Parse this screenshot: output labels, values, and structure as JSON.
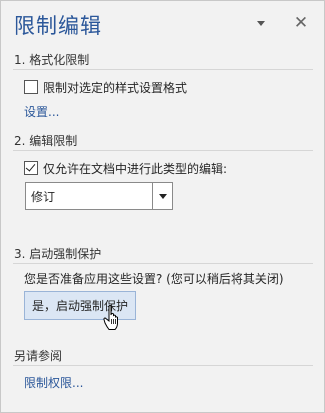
{
  "pane": {
    "title": "限制编辑",
    "menu_icon": "dropdown-triangle-icon",
    "close_icon": "close-icon",
    "close_glyph": "✕"
  },
  "formatting": {
    "heading": "1. 格式化限制",
    "checkbox_label": "限制对选定的样式设置格式",
    "checked": false,
    "settings_link": "设置..."
  },
  "editing": {
    "heading": "2. 编辑限制",
    "checkbox_label": "仅允许在文档中进行此类型的编辑:",
    "checked": true,
    "select_value": "修订"
  },
  "enforcement": {
    "heading": "3. 启动强制保护",
    "question": "您是否准备应用这些设置? (您可以稍后将其关闭)",
    "button_label": "是，启动强制保护"
  },
  "see_also": {
    "heading": "另请参阅",
    "link": "限制权限..."
  }
}
